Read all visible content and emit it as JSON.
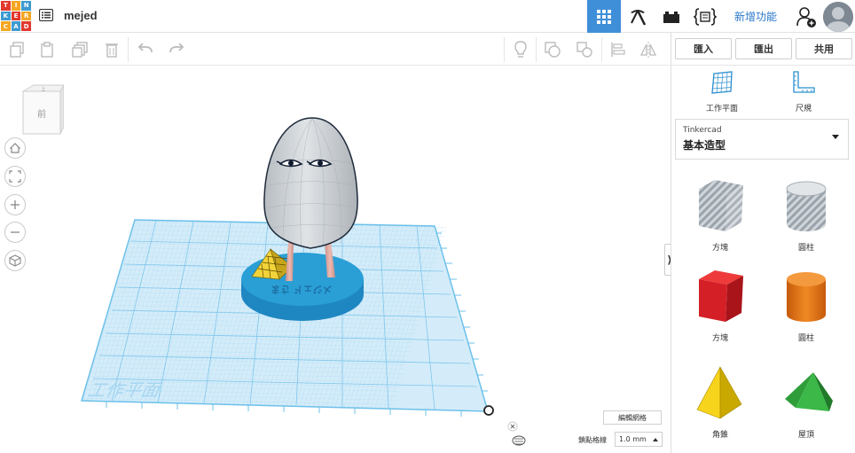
{
  "logo": {
    "letters": [
      "T",
      "I",
      "N",
      "K",
      "E",
      "R",
      "C",
      "A",
      "D"
    ],
    "colors": [
      "#e2382e",
      "#f5a623",
      "#3d9ad1",
      "#3d9ad1",
      "#e2382e",
      "#f5a623",
      "#f5a623",
      "#3d9ad1",
      "#e2382e"
    ]
  },
  "header": {
    "doc_title": "mejed",
    "new_features": "新增功能"
  },
  "actions": {
    "import": "匯入",
    "export": "匯出",
    "share": "共用"
  },
  "tools": {
    "workplane": "工作平面",
    "ruler": "尺規"
  },
  "library": {
    "source": "Tinkercad",
    "name": "基本造型"
  },
  "shapes": [
    {
      "label": "方塊",
      "icon": "striped-box-icon"
    },
    {
      "label": "圓柱",
      "icon": "striped-cylinder-icon"
    },
    {
      "label": "方塊",
      "icon": "red-box-icon"
    },
    {
      "label": "圓柱",
      "icon": "orange-cylinder-icon"
    },
    {
      "label": "角錐",
      "icon": "yellow-pyramid-icon"
    },
    {
      "label": "屋頂",
      "icon": "green-roof-icon"
    }
  ],
  "viewcube": {
    "top_face": "上",
    "front_face": "前"
  },
  "workplane_label": "工作平面",
  "base_text": "メジェド さま",
  "footer": {
    "edit_grid": "編輯網格",
    "snap_label": "鎖點格線",
    "snap_value": "1.0 mm"
  },
  "colors": {
    "accent": "#3f8fd8",
    "grid": "#9fd3f0",
    "base": "#2a9fd6",
    "ghost": "#c3c8cc"
  }
}
